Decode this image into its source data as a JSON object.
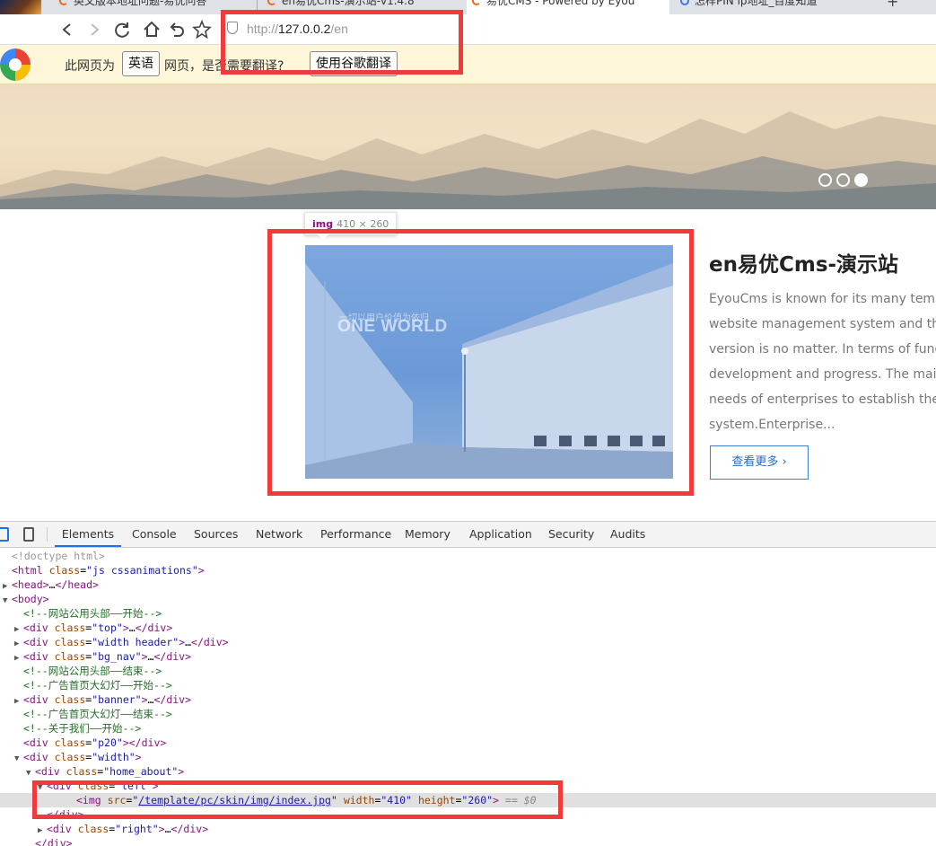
{
  "browser": {
    "tabs": [
      {
        "title": "英文版本地址问题-易优问答"
      },
      {
        "title": "en易优Cms-演示站-v1.4.8"
      },
      {
        "title": "易优CMS - Powered by Eyou"
      },
      {
        "title": "怎样PIN ip地址_百度知道"
      }
    ],
    "new_tab": "+",
    "close_glyph": "×",
    "url_scheme": "http://",
    "url_host": "127.0.0.2",
    "url_path": "/en"
  },
  "translate_bar": {
    "text_prefix": "此网页为",
    "language_button": "英语",
    "text_suffix": "网页，是否需要翻译?",
    "translate_button": "使用谷歌翻译"
  },
  "inspector_tooltip": {
    "tag": "img",
    "dimensions": "410 × 260"
  },
  "about": {
    "image_small_text": "一切以用户价值为依归",
    "image_big_text": "ONE WORLD",
    "title": "en易优Cms-演示站",
    "description_lines": [
      "EyouCms is known for its many templa",
      "website management system and the n",
      "version is no matter. In terms of functio",
      "development and progress. The main t",
      "needs of enterprises to establish their s",
      "system.Enterprise..."
    ],
    "more_button": "查看更多 ›"
  },
  "devtools": {
    "tabs": [
      "Elements",
      "Console",
      "Sources",
      "Network",
      "Performance",
      "Memory",
      "Application",
      "Security",
      "Audits"
    ],
    "active_tab": "Elements"
  },
  "dom_lines": [
    {
      "indent": 0,
      "arrow": "",
      "html": "<span class='t-doctype'>&lt;!doctype html&gt;</span>"
    },
    {
      "indent": 0,
      "arrow": "",
      "html": "<span class='t-tag'>&lt;html</span> <span class='t-attr'>class</span>=<span class='t-val'>\"js cssanimations\"</span><span class='t-tag'>&gt;</span>"
    },
    {
      "indent": 0,
      "arrow": "▶",
      "html": "<span class='t-tag'>&lt;head&gt;</span>…<span class='t-tag'>&lt;/head&gt;</span>"
    },
    {
      "indent": 0,
      "arrow": "▼",
      "html": "<span class='t-tag'>&lt;body&gt;</span>"
    },
    {
      "indent": 1,
      "arrow": "",
      "html": "<span class='t-comment'>&lt;!--网站公用头部——开始--&gt;</span>"
    },
    {
      "indent": 1,
      "arrow": "▶",
      "html": "<span class='t-tag'>&lt;div</span> <span class='t-attr'>class</span>=<span class='t-val'>\"top\"</span><span class='t-tag'>&gt;</span>…<span class='t-tag'>&lt;/div&gt;</span>"
    },
    {
      "indent": 1,
      "arrow": "▶",
      "html": "<span class='t-tag'>&lt;div</span> <span class='t-attr'>class</span>=<span class='t-val'>\"width header\"</span><span class='t-tag'>&gt;</span>…<span class='t-tag'>&lt;/div&gt;</span>"
    },
    {
      "indent": 1,
      "arrow": "▶",
      "html": "<span class='t-tag'>&lt;div</span> <span class='t-attr'>class</span>=<span class='t-val'>\"bg_nav\"</span><span class='t-tag'>&gt;</span>…<span class='t-tag'>&lt;/div&gt;</span>"
    },
    {
      "indent": 1,
      "arrow": "",
      "html": "<span class='t-comment'>&lt;!--网站公用头部——结束--&gt;</span>"
    },
    {
      "indent": 1,
      "arrow": "",
      "html": "<span class='t-comment'>&lt;!--广告首页大幻灯——开始--&gt;</span>"
    },
    {
      "indent": 1,
      "arrow": "▶",
      "html": "<span class='t-tag'>&lt;div</span> <span class='t-attr'>class</span>=<span class='t-val'>\"banner\"</span><span class='t-tag'>&gt;</span>…<span class='t-tag'>&lt;/div&gt;</span>"
    },
    {
      "indent": 1,
      "arrow": "",
      "html": "<span class='t-comment'>&lt;!--广告首页大幻灯——结束--&gt;</span>"
    },
    {
      "indent": 1,
      "arrow": "",
      "html": "<span class='t-comment'>&lt;!--关于我们——开始--&gt;</span>"
    },
    {
      "indent": 1,
      "arrow": "",
      "html": "<span class='t-tag'>&lt;div</span> <span class='t-attr'>class</span>=<span class='t-val'>\"p20\"</span><span class='t-tag'>&gt;&lt;/div&gt;</span>"
    },
    {
      "indent": 1,
      "arrow": "▼",
      "html": "<span class='t-tag'>&lt;div</span> <span class='t-attr'>class</span>=<span class='t-val'>\"width\"</span><span class='t-tag'>&gt;</span>"
    },
    {
      "indent": 2,
      "arrow": "▼",
      "html": "<span class='t-tag'>&lt;div</span> <span class='t-attr'>class</span>=<span class='t-val'>\"home_about\"</span><span class='t-tag'>&gt;</span>"
    },
    {
      "indent": 3,
      "arrow": "▼",
      "html": "<span class='t-tag'>&lt;div</span> <span class='t-attr'>class</span>=<span class='t-val'>\"left\"</span><span class='t-tag'>&gt;</span>"
    },
    {
      "indent": 4,
      "arrow": "",
      "selected": true,
      "html": "<span class='t-tag'>&lt;img</span> <span class='t-attr'>src</span>=<span class='t-val'>\"<span class='t-link'>/template/pc/skin/img/index.jpg</span>\"</span> <span class='t-attr'>width</span>=<span class='t-val'>\"410\"</span> <span class='t-attr'>height</span>=<span class='t-val'>\"260\"</span><span class='t-tag'>&gt;</span> <span class='t-eq'>== $0</span>"
    },
    {
      "indent": 3,
      "arrow": "",
      "html": "<span class='t-tag'>&lt;/div&gt;</span>"
    },
    {
      "indent": 3,
      "arrow": "▶",
      "html": "<span class='t-tag'>&lt;div</span> <span class='t-attr'>class</span>=<span class='t-val'>\"right\"</span><span class='t-tag'>&gt;</span>…<span class='t-tag'>&lt;/div&gt;</span>"
    },
    {
      "indent": 2,
      "arrow": "",
      "html": "<span class='t-tag'>&lt;/div&gt;</span>"
    }
  ],
  "colors": {
    "annotation": "#ef3b3b",
    "translate_bar_bg": "#fdf6d8",
    "devtools_tag": "#881280",
    "devtools_attr": "#994500",
    "devtools_value": "#1a1aa6",
    "devtools_comment": "#236e25",
    "link_blue": "#2a6cc0"
  },
  "icons": {
    "back": "arrow-left-icon",
    "forward": "arrow-right-icon",
    "reload": "reload-icon",
    "home": "home-icon",
    "undo": "undo-icon",
    "bookmark": "star-icon",
    "security": "shield-icon",
    "translate": "translate-logo-icon",
    "inspect": "inspect-element-icon",
    "device": "device-toolbar-icon"
  }
}
